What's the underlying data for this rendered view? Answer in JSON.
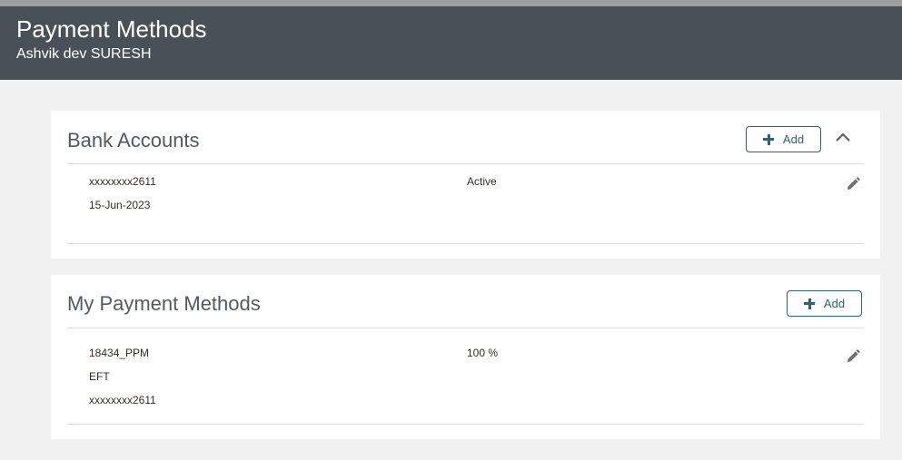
{
  "header": {
    "title": "Payment Methods",
    "subtitle": "Ashvik dev SURESH",
    "bg_color": "#475157"
  },
  "bank_accounts": {
    "title": "Bank Accounts",
    "add_label": "Add",
    "collapse_icon": "chevron-up-icon",
    "rows": [
      {
        "account": "xxxxxxxx2611",
        "date": "15-Jun-2023",
        "status": "Active",
        "edit_icon": "pencil-icon"
      }
    ]
  },
  "payment_methods": {
    "title": "My Payment Methods",
    "add_label": "Add",
    "rows": [
      {
        "name": "18434_PPM",
        "type": "EFT",
        "account": "xxxxxxxx2611",
        "percentage": "100 %",
        "edit_icon": "pencil-icon"
      }
    ]
  },
  "accent_color": "#2b6479"
}
